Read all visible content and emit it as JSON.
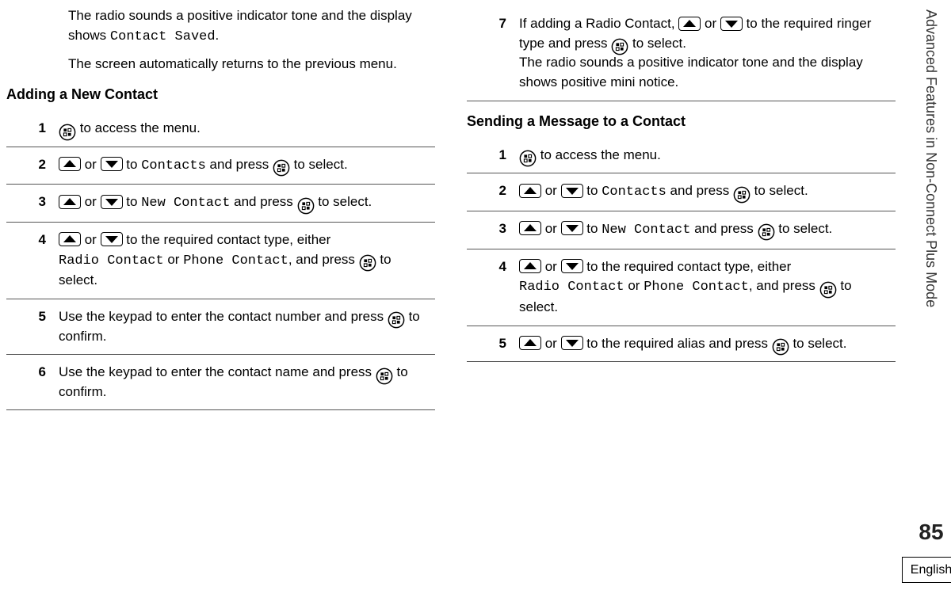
{
  "sidebar": {
    "chapter": "Advanced Features in Non-Connect Plus Mode",
    "page": "85",
    "language": "English"
  },
  "left": {
    "intro": [
      {
        "pre": "The radio sounds a positive indicator tone and the display shows ",
        "mono": "Contact Saved",
        "post": "."
      },
      {
        "pre": "The screen automatically returns to the previous menu.",
        "mono": "",
        "post": ""
      }
    ],
    "heading": "Adding a New Contact",
    "steps": [
      {
        "n": "1",
        "parts": [
          {
            "icon": "ok"
          },
          {
            "t": " to access the menu."
          }
        ]
      },
      {
        "n": "2",
        "parts": [
          {
            "icon": "up"
          },
          {
            "t": " or "
          },
          {
            "icon": "down"
          },
          {
            "t": " to "
          },
          {
            "mono": "Contacts"
          },
          {
            "t": " and press "
          },
          {
            "icon": "ok"
          },
          {
            "t": " to select."
          }
        ]
      },
      {
        "n": "3",
        "parts": [
          {
            "icon": "up"
          },
          {
            "t": " or "
          },
          {
            "icon": "down"
          },
          {
            "t": " to "
          },
          {
            "mono": "New Contact"
          },
          {
            "t": " and press "
          },
          {
            "icon": "ok"
          },
          {
            "t": " to select."
          }
        ]
      },
      {
        "n": "4",
        "parts": [
          {
            "icon": "up"
          },
          {
            "t": " or "
          },
          {
            "icon": "down"
          },
          {
            "t": " to the required contact type, either "
          },
          {
            "mono": "Radio Contact"
          },
          {
            "t": " or "
          },
          {
            "mono": "Phone Contact"
          },
          {
            "t": ", and press "
          },
          {
            "icon": "ok"
          },
          {
            "t": " to select."
          }
        ]
      },
      {
        "n": "5",
        "parts": [
          {
            "t": "Use the keypad to enter the contact number and press "
          },
          {
            "icon": "ok"
          },
          {
            "t": " to confirm."
          }
        ]
      },
      {
        "n": "6",
        "parts": [
          {
            "t": "Use the keypad to enter the contact name and press "
          },
          {
            "icon": "ok"
          },
          {
            "t": " to confirm."
          }
        ]
      }
    ]
  },
  "right": {
    "steps_top": [
      {
        "n": "7",
        "parts": [
          {
            "t": "If adding a Radio Contact, "
          },
          {
            "icon": "up"
          },
          {
            "t": " or "
          },
          {
            "icon": "down"
          },
          {
            "t": " to the required ringer type and press "
          },
          {
            "icon": "ok"
          },
          {
            "t": " to select."
          },
          {
            "br": true
          },
          {
            "t": "The radio sounds a positive indicator tone and the display shows positive mini notice."
          }
        ]
      }
    ],
    "heading": "Sending a Message to a Contact",
    "steps": [
      {
        "n": "1",
        "parts": [
          {
            "icon": "ok"
          },
          {
            "t": " to access the menu."
          }
        ]
      },
      {
        "n": "2",
        "parts": [
          {
            "icon": "up"
          },
          {
            "t": " or "
          },
          {
            "icon": "down"
          },
          {
            "t": " to "
          },
          {
            "mono": "Contacts"
          },
          {
            "t": " and press "
          },
          {
            "icon": "ok"
          },
          {
            "t": " to select."
          }
        ]
      },
      {
        "n": "3",
        "parts": [
          {
            "icon": "up"
          },
          {
            "t": " or "
          },
          {
            "icon": "down"
          },
          {
            "t": " to "
          },
          {
            "mono": "New Contact"
          },
          {
            "t": " and press "
          },
          {
            "icon": "ok"
          },
          {
            "t": " to select."
          }
        ]
      },
      {
        "n": "4",
        "parts": [
          {
            "icon": "up"
          },
          {
            "t": " or "
          },
          {
            "icon": "down"
          },
          {
            "t": " to the required contact type, either "
          },
          {
            "mono": "Radio Contact"
          },
          {
            "t": " or "
          },
          {
            "mono": "Phone Contact"
          },
          {
            "t": ", and press "
          },
          {
            "icon": "ok"
          },
          {
            "t": " to select."
          }
        ]
      },
      {
        "n": "5",
        "parts": [
          {
            "icon": "up"
          },
          {
            "t": " or "
          },
          {
            "icon": "down"
          },
          {
            "t": " to the required alias and press "
          },
          {
            "icon": "ok"
          },
          {
            "t": " to select."
          }
        ]
      }
    ]
  }
}
